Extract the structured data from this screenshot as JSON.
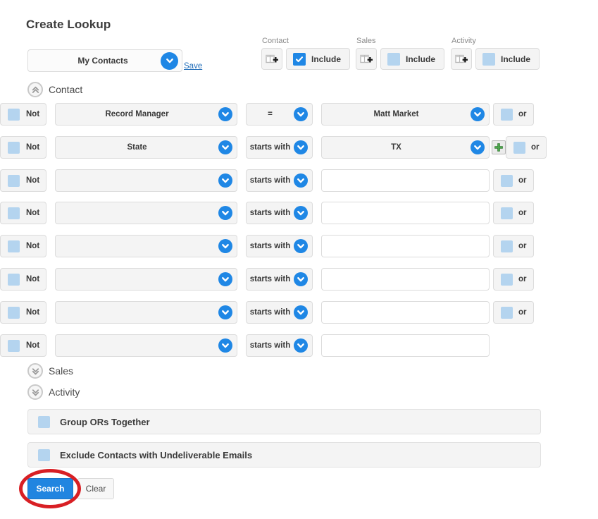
{
  "page_title": "Create Lookup",
  "saved_search": {
    "value": "My Contacts",
    "save_label": "Save",
    "dropdown_icon": "chevron-down-icon"
  },
  "include_groups": [
    {
      "caption": "Contact",
      "add_icon": "add-column-icon",
      "include_label": "Include",
      "checked": true
    },
    {
      "caption": "Sales",
      "add_icon": "add-column-icon",
      "include_label": "Include",
      "checked": false
    },
    {
      "caption": "Activity",
      "add_icon": "add-column-icon",
      "include_label": "Include",
      "checked": false
    }
  ],
  "sections": [
    {
      "label": "Contact",
      "state": "expanded",
      "icon": "double-chevron-up-icon"
    },
    {
      "label": "Sales",
      "state": "collapsed",
      "icon": "double-chevron-down-icon"
    },
    {
      "label": "Activity",
      "state": "collapsed",
      "icon": "double-chevron-down-icon"
    }
  ],
  "filter_labels": {
    "not": "Not",
    "or": "or"
  },
  "filter_rows": [
    {
      "not_label": "Not",
      "field": "Record Manager",
      "operator": "=",
      "value": "Matt Market",
      "value_is_dropdown": true,
      "or_label": "or",
      "has_or": true,
      "has_plus": false
    },
    {
      "not_label": "Not",
      "field": "State",
      "operator": "starts with",
      "value": "TX",
      "value_is_dropdown": true,
      "or_label": "or",
      "has_or": true,
      "has_plus": true
    },
    {
      "not_label": "Not",
      "field": "",
      "operator": "starts with",
      "value": "",
      "value_is_dropdown": false,
      "or_label": "or",
      "has_or": true,
      "has_plus": false
    },
    {
      "not_label": "Not",
      "field": "",
      "operator": "starts with",
      "value": "",
      "value_is_dropdown": false,
      "or_label": "or",
      "has_or": true,
      "has_plus": false
    },
    {
      "not_label": "Not",
      "field": "",
      "operator": "starts with",
      "value": "",
      "value_is_dropdown": false,
      "or_label": "or",
      "has_or": true,
      "has_plus": false
    },
    {
      "not_label": "Not",
      "field": "",
      "operator": "starts with",
      "value": "",
      "value_is_dropdown": false,
      "or_label": "or",
      "has_or": true,
      "has_plus": false
    },
    {
      "not_label": "Not",
      "field": "",
      "operator": "starts with",
      "value": "",
      "value_is_dropdown": false,
      "or_label": "or",
      "has_or": true,
      "has_plus": false
    },
    {
      "not_label": "Not",
      "field": "",
      "operator": "starts with",
      "value": "",
      "value_is_dropdown": false,
      "or_label": "or",
      "has_or": false,
      "has_plus": false
    }
  ],
  "option_bars": [
    {
      "label": "Group ORs Together",
      "checked": false
    },
    {
      "label": "Exclude Contacts with Undeliverable Emails",
      "checked": false
    }
  ],
  "footer": {
    "search_label": "Search",
    "clear_label": "Clear"
  },
  "annotation": {
    "shape": "ellipse",
    "color": "#d81f24",
    "target": "Search"
  },
  "colors": {
    "accent_blue": "#1f87e5",
    "checkbox_light": "#b4d4ef",
    "control_bg": "#f4f4f4",
    "border": "#dcdcdc",
    "link": "#1e6bb8",
    "annotation_red": "#d81f24",
    "plus_green": "#4ca64c"
  }
}
